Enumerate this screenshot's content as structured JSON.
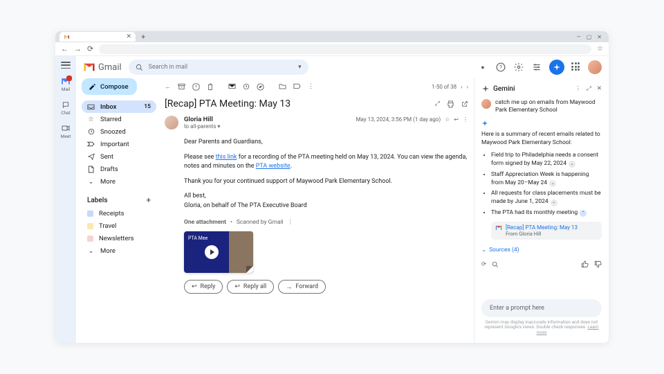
{
  "browser": {
    "win_min": "—",
    "win_max": "▢",
    "win_close": "✕"
  },
  "rail": [
    {
      "label": "Mail"
    },
    {
      "label": "Chat"
    },
    {
      "label": "Meet"
    }
  ],
  "logo": "Gmail",
  "search": {
    "placeholder": "Search in mail"
  },
  "compose": "Compose",
  "nav": [
    {
      "label": "Inbox",
      "count": "15",
      "active": true
    },
    {
      "label": "Starred"
    },
    {
      "label": "Snoozed"
    },
    {
      "label": "Important"
    },
    {
      "label": "Sent"
    },
    {
      "label": "Drafts"
    },
    {
      "label": "More"
    }
  ],
  "labels_header": "Labels",
  "labels": [
    {
      "label": "Receipts",
      "color": "#c5dafc"
    },
    {
      "label": "Travel",
      "color": "#fce8b2"
    },
    {
      "label": "Newsletters",
      "color": "#fad2cf"
    },
    {
      "label": "More"
    }
  ],
  "toolbar": {
    "page_info": "1-50 of 38"
  },
  "email": {
    "subject": "[Recap] PTA Meeting: May 13",
    "sender_name": "Gloria Hill",
    "date": "May 13, 2024, 3:56 PM (1 day ago)",
    "to": "to all-parents",
    "greeting": "Dear Parents and Guardians,",
    "p1_a": "Please see ",
    "p1_link1": "this link",
    "p1_b": " for a recording of the PTA meeting held on May 13, 2024. You can view the agenda, notes and minutes on the ",
    "p1_link2": "PTA website",
    "p1_c": ".",
    "p2": "Thank you for your continued support of Maywood Park Elementary School.",
    "closing1": "All best,",
    "closing2": "Gloria, on behalf of The PTA Executive Board",
    "attach_label": "One attachment",
    "scanned": "Scanned by Gmail",
    "att_title": "PTA Mee",
    "reply": "Reply",
    "reply_all": "Reply all",
    "forward": "Forward"
  },
  "gemini": {
    "title": "Gemini",
    "user_prompt": "catch me up on emails from Maywood Park Elementary School",
    "summary_intro": "Here is a summary of recent emails related to Maywood Park Elementary School:",
    "items": [
      "Field trip to Philadelphia needs a consent form signed by May 22, 2024",
      "Staff Appreciation Week is happening from May 20–May 24",
      "All requests for class placements must be made by June 1, 2024",
      "The PTA had its monthly meeting"
    ],
    "ref_title": "[Recap] PTA Meeting: May 13",
    "ref_from": "From Gloria Hill",
    "sources": "Sources (4)",
    "input_placeholder": "Enter a prompt here",
    "disclaimer": "Gemini may display inaccurate information and does not represent Google's views. Double check responses. ",
    "learn_more": "Learn more"
  }
}
